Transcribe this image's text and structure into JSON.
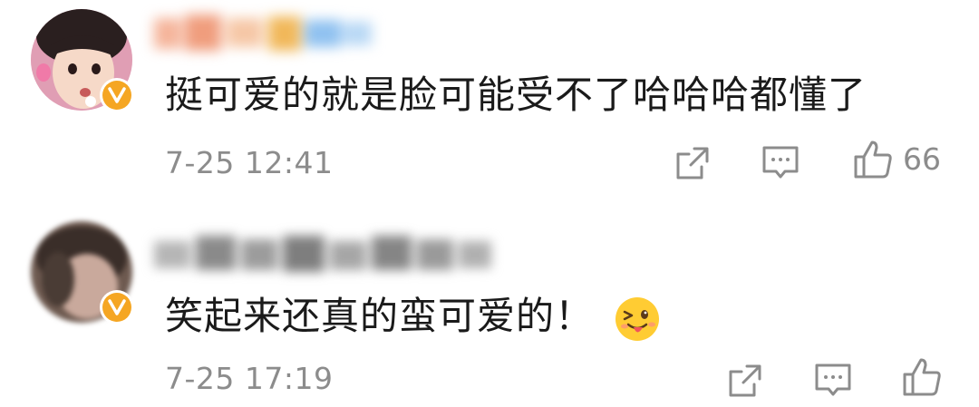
{
  "comments": [
    {
      "text": "挺可爱的就是脸可能受不了哈哈哈都懂了",
      "timestamp": "7-25 12:41",
      "like_count": "66",
      "avatar": "child-portrait-avatar",
      "verified_badge": "verified-v-icon",
      "username_blurred": true
    },
    {
      "text": "笑起来还真的蛮可爱的！",
      "emoji": "tongue-out-wink-emoji",
      "timestamp": "7-25 17:19",
      "like_count": "",
      "avatar": "blurred-avatar",
      "verified_badge": "verified-v-icon",
      "username_blurred": true
    }
  ],
  "actions": {
    "share_icon": "share-icon",
    "reply_icon": "comment-icon",
    "like_icon": "thumbs-up-icon"
  },
  "colors": {
    "text": "#1a1a1a",
    "meta": "#8c8c8c",
    "verified": "#f5a623"
  }
}
